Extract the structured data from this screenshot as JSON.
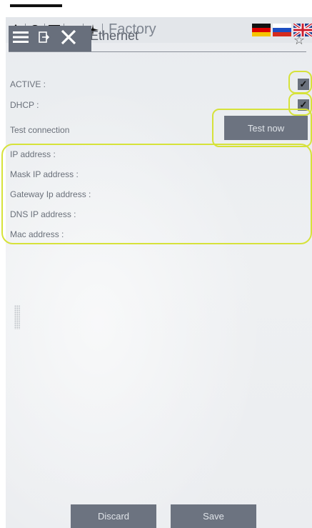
{
  "modebar": {
    "title": "Factory",
    "icons": [
      "water-drop-icon",
      "tire-icon",
      "film-icon",
      "machine-icon",
      "airplane-icon"
    ]
  },
  "header": {
    "title": "Ethernet",
    "tools": [
      "menu-icon",
      "export-icon",
      "close-icon"
    ],
    "favorite_icon": "star-icon"
  },
  "settings": {
    "active_label": "ACTIVE :",
    "active_checked": true,
    "dhcp_label": "DHCP :",
    "dhcp_checked": true,
    "test_label": "Test connection",
    "test_button": "Test now"
  },
  "network": {
    "ip_label": "IP address :",
    "mask_label": "Mask IP address :",
    "gateway_label": "Gateway Ip address :",
    "dns_label": "DNS IP address :",
    "mac_label": "Mac address :"
  },
  "footer": {
    "discard": "Discard",
    "save": "Save"
  },
  "colors": {
    "accent_highlight": "#d6e23a",
    "button": "#6c7380",
    "toolbar": "#686f7c"
  }
}
